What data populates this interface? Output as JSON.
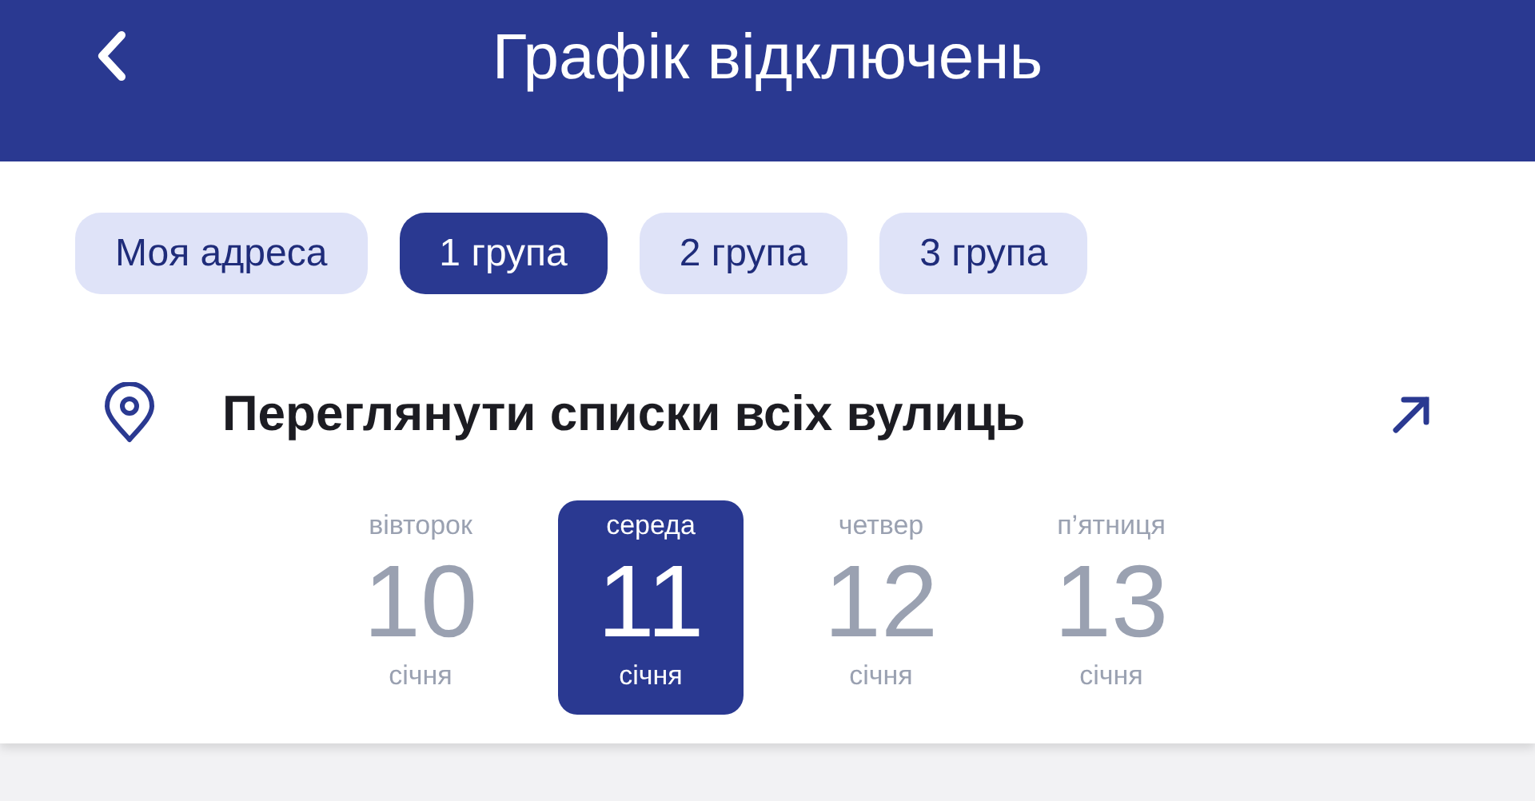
{
  "header": {
    "title": "Графік відключень"
  },
  "tabs": [
    {
      "label": "Моя адреса",
      "selected": false
    },
    {
      "label": "1 група",
      "selected": true
    },
    {
      "label": "2 група",
      "selected": false
    },
    {
      "label": "3 група",
      "selected": false
    }
  ],
  "streets_link": {
    "label": "Переглянути списки всіх вулиць"
  },
  "days": [
    {
      "weekday": "вівторок",
      "day": "10",
      "month": "січня",
      "selected": false
    },
    {
      "weekday": "середа",
      "day": "11",
      "month": "січня",
      "selected": true
    },
    {
      "weekday": "четвер",
      "day": "12",
      "month": "січня",
      "selected": false
    },
    {
      "weekday": "п’ятниця",
      "day": "13",
      "month": "січня",
      "selected": false
    }
  ]
}
